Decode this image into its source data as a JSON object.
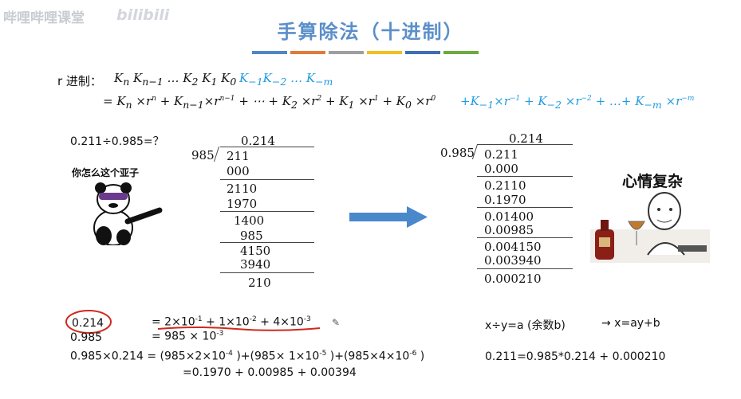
{
  "watermark": {
    "text": "哔哩哔哩课堂",
    "logo": "bilibili"
  },
  "title": "手算除法（十进制）",
  "color_bars": [
    "#4f86c6",
    "#e07b39",
    "#9e9e9e",
    "#f0c020",
    "#3e6db5",
    "#6aaa3e"
  ],
  "base_r": {
    "label": "r 进制：",
    "digits": "K<sub>n</sub> K<sub>n−1</sub> … K<sub>2</sub> K<sub>1</sub> K<sub>0</sub>",
    "frac": "K<sub>−1</sub>K<sub>−2</sub> … K<sub>−m</sub>",
    "expansion": "= K<sub>n</sub> ×r<sup>n</sup> + K<sub>n−1</sub>×r<sup>n−1</sup> + ⋯ + K<sub>2</sub> ×r<sup>2</sup> + K<sub>1</sub> ×r<sup>1</sup> + K<sub>0</sub> ×r<sup>0</sup>",
    "expansion_frac": "+K<sub>−1</sub>×r<sup>−1</sup> + K<sub>−2</sub> ×r<sup>−2</sup> + …+ K<sub>−m</sub> ×r<sup>−m</sup>"
  },
  "question": "0.211÷0.985=？",
  "meme_left": {
    "caption": "你怎么这个亚子"
  },
  "meme_right": {
    "caption": "心情复杂"
  },
  "long_div_int": {
    "quotient": "0.214",
    "divisor": "985",
    "rows": [
      "211",
      "000",
      "2110",
      "1970",
      "1400",
      "985",
      "4150",
      "3940",
      "210"
    ]
  },
  "long_div_dec": {
    "quotient": "0.214",
    "divisor": "0.985",
    "rows": [
      "0.211",
      "0.000",
      "0.2110",
      "0.1970",
      "0.01400",
      "0.00985",
      "0.004150",
      "0.003940",
      "0.000210"
    ]
  },
  "bottom": {
    "circled": "0.214",
    "eq1": "= 2×10<sup>-1</sup> + 1×10<sup>-2</sup> + 4×10<sup>-3</sup>",
    "left2": "0.985",
    "eq2": "= 985 × 10<sup>-3</sup>",
    "prod": "0.985×0.214 = (985×2×10<sup>-4</sup> )+(985× 1×10<sup>-5</sup> )+(985×4×10<sup>-6</sup> )",
    "prod2": "=0.1970 + 0.00985 + 0.00394",
    "rule": "x÷y=a (余数b)",
    "arrow": "→ x=ay+b",
    "check": "0.211=0.985*0.214 + 0.000210"
  }
}
